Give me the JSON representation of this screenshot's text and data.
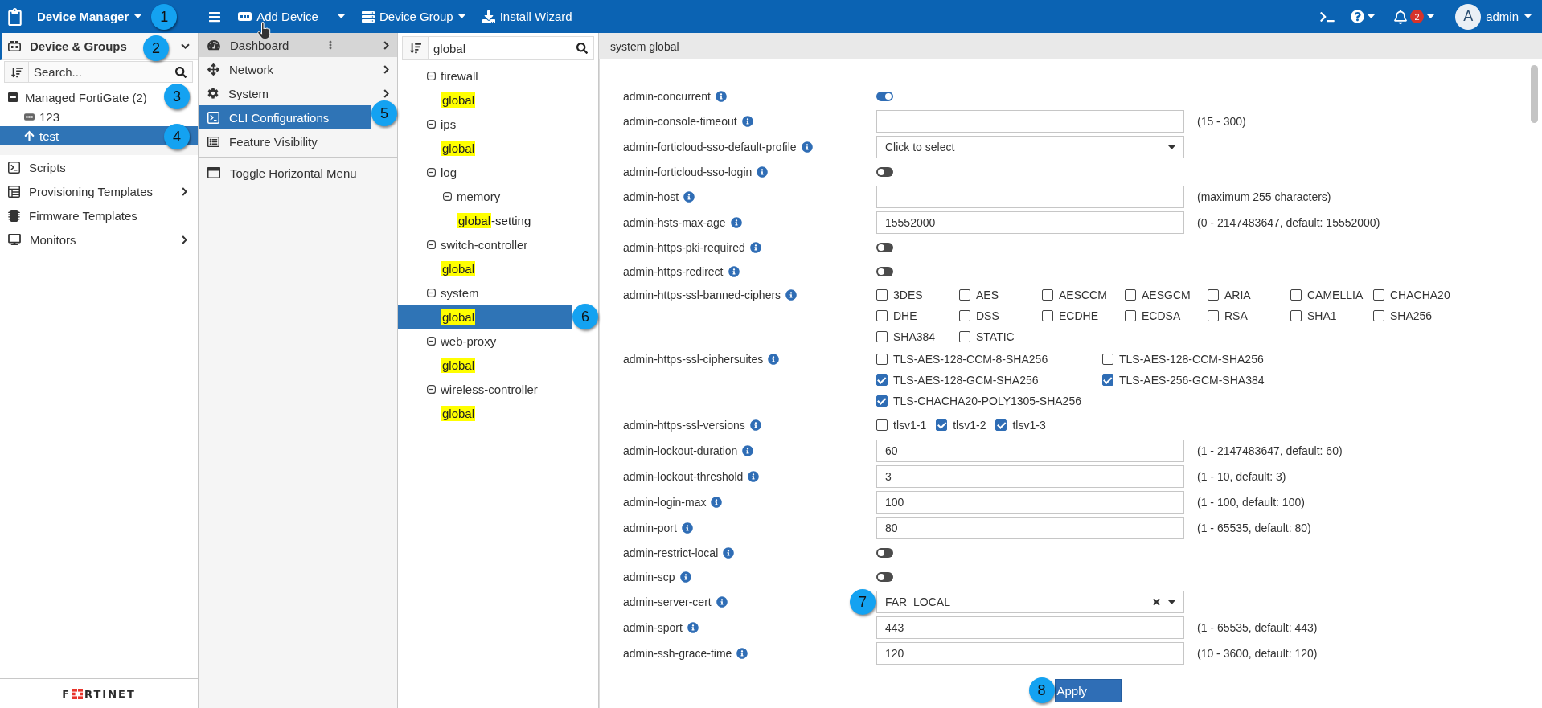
{
  "top_bar": {
    "app_menu": {
      "label": "Device Manager",
      "callout": "1"
    },
    "actions": [
      {
        "label": "Add Device",
        "kind": "split"
      },
      {
        "label": "Device Group",
        "kind": "dropdown"
      },
      {
        "label": "Install Wizard",
        "kind": "plain"
      }
    ],
    "notifications": {
      "count": "2"
    },
    "user": {
      "initial": "A",
      "name": "admin"
    }
  },
  "sidebar": {
    "header": {
      "label": "Device & Groups",
      "callout": "2"
    },
    "search": {
      "placeholder": "Search..."
    },
    "tree": [
      {
        "label": "Managed FortiGate (2)",
        "expanded": true,
        "selected": false,
        "callout": "3",
        "children": [
          {
            "label": "123",
            "kind": "device",
            "selected": false
          },
          {
            "label": "test",
            "kind": "upgrade",
            "selected": true,
            "callout": "4"
          }
        ]
      }
    ],
    "nav": [
      {
        "label": "Scripts",
        "submenu": false
      },
      {
        "label": "Provisioning Templates",
        "submenu": true
      },
      {
        "label": "Firmware Templates",
        "submenu": false
      },
      {
        "label": "Monitors",
        "submenu": true
      }
    ],
    "logo": {
      "before": "F",
      "after": "RTINET"
    }
  },
  "menu": {
    "items": [
      {
        "label": "Dashboard",
        "selected": false,
        "hovered": true,
        "options": true,
        "submenu": true
      },
      {
        "label": "Network",
        "selected": false,
        "hovered": false,
        "options": false,
        "submenu": true
      },
      {
        "label": "System",
        "selected": false,
        "hovered": false,
        "options": false,
        "submenu": true
      },
      {
        "label": "CLI Configurations",
        "selected": true,
        "hovered": false,
        "options": false,
        "submenu": false,
        "callout": "5"
      },
      {
        "label": "Feature Visibility",
        "selected": false,
        "hovered": false,
        "options": false,
        "submenu": false
      }
    ],
    "toggle": {
      "label": "Toggle Horizontal Menu"
    }
  },
  "cli_tree": {
    "search": {
      "value": "global"
    },
    "nodes": [
      {
        "kind": "group",
        "label": "firewall",
        "expanded": true,
        "children": [
          {
            "kind": "leaf",
            "parts": [
              {
                "text": "global",
                "highlighted": true
              }
            ],
            "selected": false
          }
        ]
      },
      {
        "kind": "group",
        "label": "ips",
        "expanded": true,
        "children": [
          {
            "kind": "leaf",
            "parts": [
              {
                "text": "global",
                "highlighted": true
              }
            ],
            "selected": false
          }
        ]
      },
      {
        "kind": "group",
        "label": "log",
        "expanded": true,
        "children": [
          {
            "kind": "group",
            "label": "memory",
            "expanded": true,
            "children": [
              {
                "kind": "leaf",
                "parts": [
                  {
                    "text": "global",
                    "highlighted": true
                  },
                  {
                    "text": "-setting",
                    "highlighted": false
                  }
                ],
                "selected": false
              }
            ]
          }
        ]
      },
      {
        "kind": "group",
        "label": "switch-controller",
        "expanded": true,
        "children": [
          {
            "kind": "leaf",
            "parts": [
              {
                "text": "global",
                "highlighted": true
              }
            ],
            "selected": false
          }
        ]
      },
      {
        "kind": "group",
        "label": "system",
        "expanded": true,
        "children": [
          {
            "kind": "leaf",
            "parts": [
              {
                "text": "global",
                "highlighted": true
              }
            ],
            "selected": true,
            "callout": "6"
          }
        ]
      },
      {
        "kind": "group",
        "label": "web-proxy",
        "expanded": true,
        "children": [
          {
            "kind": "leaf",
            "parts": [
              {
                "text": "global",
                "highlighted": true
              }
            ],
            "selected": false
          }
        ]
      },
      {
        "kind": "group",
        "label": "wireless-controller",
        "expanded": true,
        "children": [
          {
            "kind": "leaf",
            "parts": [
              {
                "text": "global",
                "highlighted": true
              }
            ],
            "selected": false
          }
        ]
      }
    ]
  },
  "settings": {
    "title": "system global",
    "rows": [
      {
        "kind": "toggle",
        "label": "admin-concurrent",
        "on": true
      },
      {
        "kind": "text",
        "label": "admin-console-timeout",
        "hint": "(15 - 300)"
      },
      {
        "kind": "select",
        "label": "admin-forticloud-sso-default-profile",
        "placeholder": "Click to select"
      },
      {
        "kind": "toggle",
        "label": "admin-forticloud-sso-login",
        "on": false
      },
      {
        "kind": "text",
        "label": "admin-host",
        "hint": "(maximum 255 characters)"
      },
      {
        "kind": "text",
        "label": "admin-hsts-max-age",
        "value": "15552000",
        "hint": "(0 - 2147483647, default: 15552000)"
      },
      {
        "kind": "toggle",
        "label": "admin-https-pki-required",
        "on": false
      },
      {
        "kind": "toggle",
        "label": "admin-https-redirect",
        "on": false
      },
      {
        "kind": "checkbox_grid",
        "label": "admin-https-ssl-banned-ciphers",
        "options": [
          {
            "label": "3DES",
            "checked": false
          },
          {
            "label": "AES",
            "checked": false
          },
          {
            "label": "AESCCM",
            "checked": false
          },
          {
            "label": "AESGCM",
            "checked": false
          },
          {
            "label": "ARIA",
            "checked": false
          },
          {
            "label": "CAMELLIA",
            "checked": false
          },
          {
            "label": "CHACHA20",
            "checked": false
          },
          {
            "label": "DHE",
            "checked": false
          },
          {
            "label": "DSS",
            "checked": false
          },
          {
            "label": "ECDHE",
            "checked": false
          },
          {
            "label": "ECDSA",
            "checked": false
          },
          {
            "label": "RSA",
            "checked": false
          },
          {
            "label": "SHA1",
            "checked": false
          },
          {
            "label": "SHA256",
            "checked": false
          },
          {
            "label": "SHA384",
            "checked": false
          },
          {
            "label": "STATIC",
            "checked": false
          }
        ]
      },
      {
        "kind": "checkbox_grid",
        "label": "admin-https-ssl-ciphersuites",
        "options": [
          {
            "label": "TLS-AES-128-CCM-8-SHA256",
            "checked": false
          },
          {
            "label": "TLS-AES-128-CCM-SHA256",
            "checked": false
          },
          {
            "label": "TLS-AES-128-GCM-SHA256",
            "checked": true
          },
          {
            "label": "TLS-AES-256-GCM-SHA384",
            "checked": true
          },
          {
            "label": "TLS-CHACHA20-POLY1305-SHA256",
            "checked": true
          }
        ]
      },
      {
        "kind": "checkbox_inline",
        "label": "admin-https-ssl-versions",
        "options": [
          {
            "label": "tlsv1-1",
            "checked": false
          },
          {
            "label": "tlsv1-2",
            "checked": true
          },
          {
            "label": "tlsv1-3",
            "checked": true
          }
        ]
      },
      {
        "kind": "text",
        "label": "admin-lockout-duration",
        "value": "60",
        "hint": "(1 - 2147483647, default: 60)"
      },
      {
        "kind": "text",
        "label": "admin-lockout-threshold",
        "value": "3",
        "hint": "(1 - 10, default: 3)"
      },
      {
        "kind": "text",
        "label": "admin-login-max",
        "value": "100",
        "hint": "(1 - 100, default: 100)"
      },
      {
        "kind": "text",
        "label": "admin-port",
        "value": "80",
        "hint": "(1 - 65535, default: 80)"
      },
      {
        "kind": "toggle",
        "label": "admin-restrict-local",
        "on": false
      },
      {
        "kind": "toggle",
        "label": "admin-scp",
        "on": false
      },
      {
        "kind": "select",
        "label": "admin-server-cert",
        "value": "FAR_LOCAL",
        "callout": "7"
      },
      {
        "kind": "text",
        "label": "admin-sport",
        "value": "443",
        "hint": "(1 - 65535, default: 443)"
      },
      {
        "kind": "text",
        "label": "admin-ssh-grace-time",
        "value": "120",
        "hint": "(10 - 3600, default: 120)"
      }
    ],
    "apply": {
      "label": "Apply",
      "callout": "8"
    }
  }
}
